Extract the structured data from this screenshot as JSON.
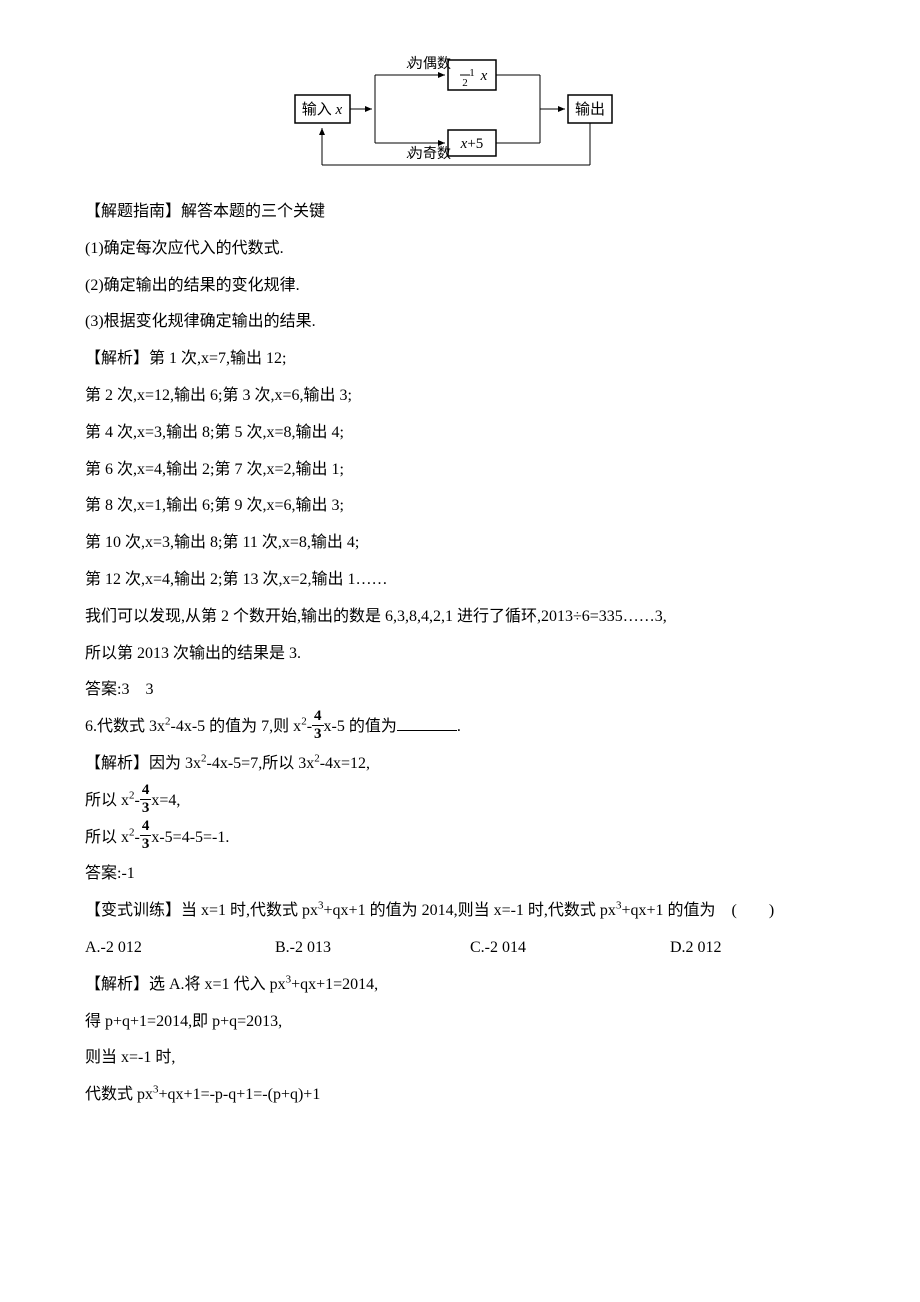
{
  "flowchart": {
    "input": "输入 x",
    "even_label": "x 为偶数",
    "odd_label": "x 为奇数",
    "even_op": "½ x",
    "odd_op": "x+5",
    "output": "输出"
  },
  "lines": {
    "guide_title": "【解题指南】解答本题的三个关键",
    "g1": "(1)确定每次应代入的代数式.",
    "g2": "(2)确定输出的结果的变化规律.",
    "g3": "(3)根据变化规律确定输出的结果.",
    "ana1": "【解析】第 1 次,x=7,输出 12;",
    "ana2": "第 2 次,x=12,输出 6;第 3 次,x=6,输出 3;",
    "ana3": "第 4 次,x=3,输出 8;第 5 次,x=8,输出 4;",
    "ana4": "第 6 次,x=4,输出 2;第 7 次,x=2,输出 1;",
    "ana5": "第 8 次,x=1,输出 6;第 9 次,x=6,输出 3;",
    "ana6": "第 10 次,x=3,输出 8;第 11 次,x=8,输出 4;",
    "ana7": "第 12 次,x=4,输出 2;第 13 次,x=2,输出 1……",
    "ana8": "我们可以发现,从第 2 个数开始,输出的数是 6,3,8,4,2,1 进行了循环,2013÷6=335……3,",
    "ana9": "所以第 2013 次输出的结果是 3.",
    "ans5": "答案:3　3",
    "q6_pre": "6.代数式 3x",
    "q6_mid1": "-4x-5 的值为 7,则 x",
    "q6_mid2": "x-5 的值为",
    "q6_end": ".",
    "a6_l1a": "【解析】因为 3x",
    "a6_l1b": "-4x-5=7,所以 3x",
    "a6_l1c": "-4x=12,",
    "a6_l2a": "所以 x",
    "a6_l2b": "x=4,",
    "a6_l3a": "所以 x",
    "a6_l3b": "x-5=4-5=-1.",
    "ans6": "答案:-1",
    "var_pre": "【变式训练】当 x=1 时,代数式 px",
    "var_mid1": "+qx+1 的值为 2014,则当 x=-1 时,代数式 px",
    "var_mid2": "+qx+1 的值为　(　　)",
    "optA": "A.-2 012",
    "optB": "B.-2 013",
    "optC": "C.-2 014",
    "optD": "D.2 012",
    "va_l1a": "【解析】选 A.将 x=1 代入 px",
    "va_l1b": "+qx+1=2014,",
    "va_l2": "得 p+q+1=2014,即 p+q=2013,",
    "va_l3": "则当 x=-1 时,",
    "va_l4a": "代数式 px",
    "va_l4b": "+qx+1=-p-q+1=-(p+q)+1"
  },
  "frac": {
    "num": "4",
    "den": "3"
  }
}
